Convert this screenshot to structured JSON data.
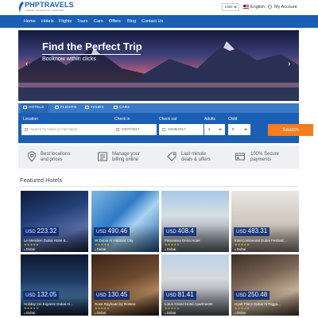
{
  "brand": {
    "title": "PHPTRAVELS",
    "subtitle": "TRAVEL TECHNOLOGY PARTNER"
  },
  "topbar": {
    "currency": "USD",
    "language": "English",
    "account": "My Account"
  },
  "nav": {
    "items": [
      "Home",
      "Hotels",
      "Flights",
      "Tours",
      "Cars",
      "Offers",
      "Blog",
      "Contact Us"
    ]
  },
  "hero": {
    "title": "Find the Perfect Trip",
    "subtitle": "Booknow within clicks",
    "prev_icon": "chevron-left-icon",
    "next_icon": "chevron-right-icon"
  },
  "search": {
    "tabs": [
      "HOTELS",
      "FLIGHTS",
      "TOURS",
      "CARS"
    ],
    "active_tab": "HOTELS",
    "location_label": "Location",
    "location_placeholder": "Search by Hotel or City Name",
    "checkin_label": "Check in",
    "checkin_value": "04/07/2017",
    "checkout_label": "Check out",
    "checkout_value": "04/08/2017",
    "adults_label": "Adults",
    "adults_value": "2",
    "child_label": "Child",
    "child_value": "0",
    "button": "Search"
  },
  "features": [
    {
      "line1": "Best locations",
      "line2": "and prices",
      "icon": "location-pin-icon"
    },
    {
      "line1": "Manage your",
      "line2": "billing online",
      "icon": "billing-icon"
    },
    {
      "line1": "Last minute",
      "line2": "deals & offers",
      "icon": "deals-tag-icon"
    },
    {
      "line1": "100% Secure",
      "line2": "payments",
      "icon": "secure-payment-icon"
    }
  ],
  "featured": {
    "title": "Featured Hotels",
    "hotels": [
      {
        "currency": "USD",
        "price": "223.32",
        "name": "Le Meridien Dubai Hotel &...",
        "location": "Dubai",
        "stars": 5
      },
      {
        "currency": "USD",
        "price": "490.46",
        "name": "W Dubai Al Habtoor City",
        "location": "Dubai",
        "stars": 5
      },
      {
        "currency": "USD",
        "price": "408.4",
        "name": "Panorama Deira Hotel",
        "location": "Dubai",
        "stars": 4
      },
      {
        "currency": "USD",
        "price": "483.31",
        "name": "InterContinental Dubai Festival...",
        "location": "Dubai",
        "stars": 5
      },
      {
        "currency": "USD",
        "price": "132.05",
        "name": "Holiday Inn Express Dubai Al...",
        "location": "Dubai",
        "stars": 3
      },
      {
        "currency": "USD",
        "price": "130.45",
        "name": "Rose Rayhaan by Rotana",
        "location": "Dubai",
        "stars": 4
      },
      {
        "currency": "USD",
        "price": "81.41",
        "name": "Lotus Grand Hotel Apartments",
        "location": "Dubai",
        "stars": 3
      },
      {
        "currency": "USD",
        "price": "250.48",
        "name": "Hyatt Place Dubai Al Rigga...",
        "location": "Dubai",
        "stars": 4
      }
    ]
  },
  "colors": {
    "primary": "#1b5fb4",
    "accent": "#f47d20",
    "star": "#f0b400"
  }
}
